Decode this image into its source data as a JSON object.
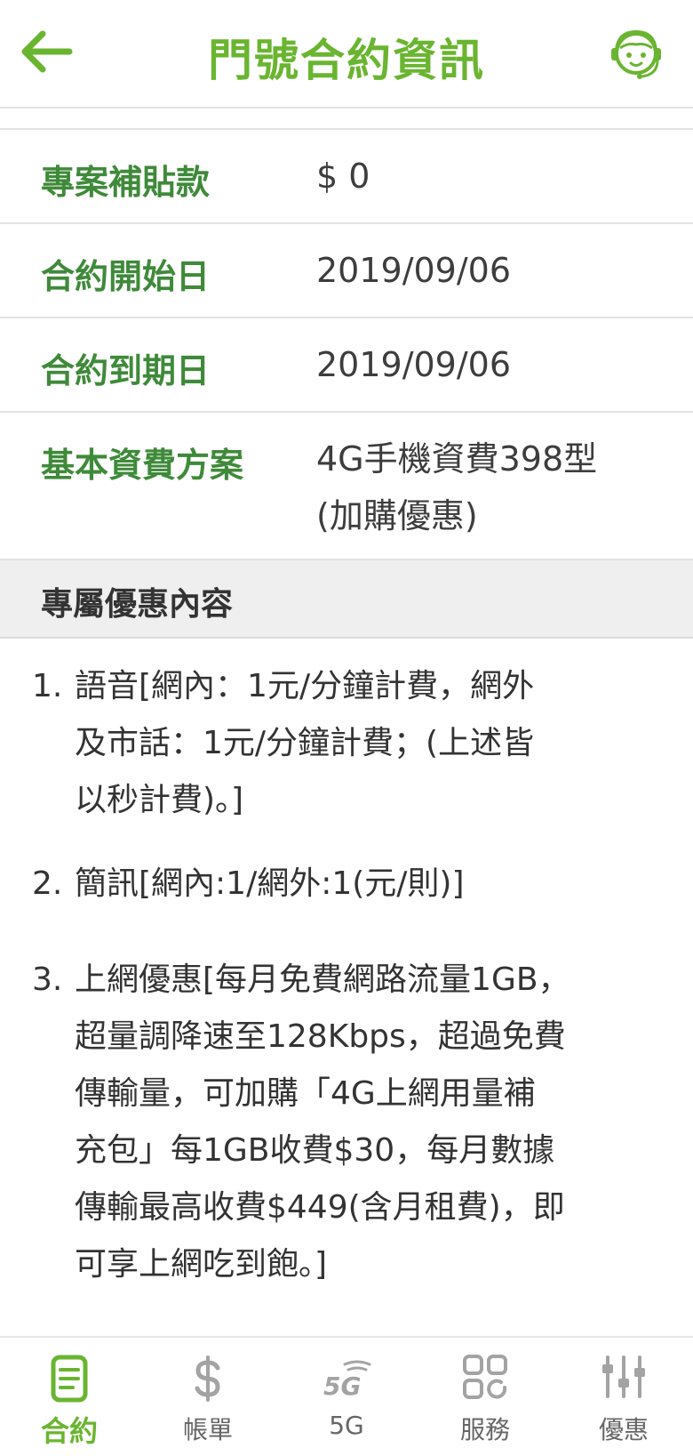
{
  "header": {
    "title": "門號合約資訊"
  },
  "contract": {
    "rows": [
      {
        "label": "專案補貼款",
        "value": "$ 0"
      },
      {
        "label": "合約開始日",
        "value": "2019/09/06"
      },
      {
        "label": "合約到期日",
        "value": "2019/09/06"
      },
      {
        "label": "基本資費方案",
        "value_lines": [
          "4G手機資費398型",
          "(加購優惠)"
        ]
      }
    ]
  },
  "offers": {
    "title": "專屬優惠內容",
    "items": [
      {
        "num": "1.",
        "lines": [
          "語音[網內：1元/分鐘計費，網外",
          "及市話：1元/分鐘計費；(上述皆",
          "以秒計費)。]"
        ]
      },
      {
        "num": "2.",
        "lines": [
          "簡訊[網內:1/網外:1(元/則)]"
        ]
      },
      {
        "num": "3.",
        "lines": [
          "上網優惠[每月免費網路流量1GB，",
          "超量調降速至128Kbps，超過免費",
          "傳輸量，可加購「4G上網用量補",
          "充包」每1GB收費$30，每月數據",
          "傳輸最高收費$449(含月租費)，即",
          "可享上網吃到飽。]"
        ]
      }
    ]
  },
  "tabbar": {
    "tabs": [
      {
        "label": "合約",
        "icon": "contract-icon",
        "active": true
      },
      {
        "label": "帳單",
        "icon": "dollar-icon",
        "active": false
      },
      {
        "label": "5G",
        "icon": "5g-icon",
        "active": false
      },
      {
        "label": "服務",
        "icon": "grid-icon",
        "active": false
      },
      {
        "label": "優惠",
        "icon": "sliders-icon",
        "active": false
      }
    ]
  },
  "colors": {
    "accent": "#6ab530",
    "label_green": "#3f8a3a",
    "icon_gray": "#a3a3a3"
  }
}
